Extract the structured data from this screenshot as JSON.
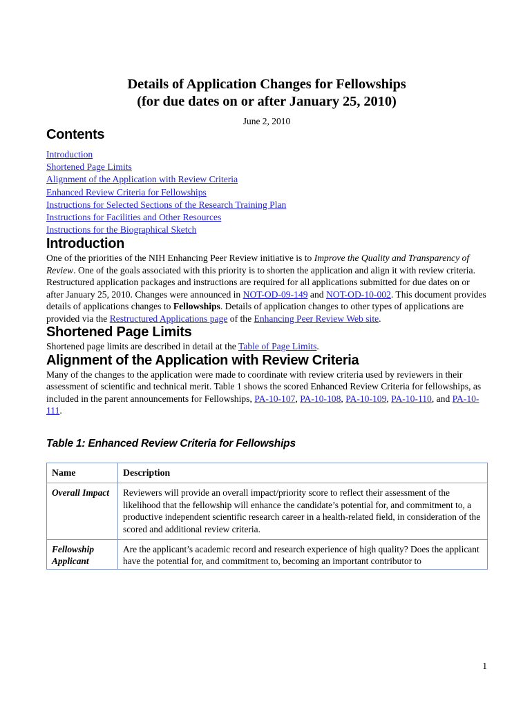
{
  "document": {
    "title_line1": "Details of Application Changes for Fellowships",
    "title_line2": "(for due dates on or after January 25, 2010)",
    "date": "June 2, 2010",
    "page_number": "1"
  },
  "contents": {
    "heading": "Contents",
    "items": [
      {
        "label": "Introduction"
      },
      {
        "label": "Shortened Page Limits"
      },
      {
        "label": "Alignment of the Application with Review Criteria"
      },
      {
        "label": "Enhanced Review Criteria for Fellowships"
      },
      {
        "label": "Instructions for Selected Sections of the Research Training Plan"
      },
      {
        "label": "Instructions for Facilities and Other Resources"
      },
      {
        "label": "Instructions for the Biographical Sketch"
      }
    ]
  },
  "introduction": {
    "heading": "Introduction",
    "para1_part1": "One of the priorities of the NIH Enhancing Peer Review initiative is to ",
    "para1_italic1": "Improve the Quality and Transparency of Review",
    "para1_part2": ".  One of the goals associated with this priority is to shorten the application and align it with review criteria.",
    "para2_part1": "Restructured application packages and instructions are required for all applications submitted for due dates on or after January 25, 2010. Changes were announced in ",
    "para2_link1": "NOT-OD-09-149",
    "para2_part2": " and ",
    "para2_link2": "NOT-OD-10-002",
    "para2_part3": ". This document provides details of applications changes to ",
    "para2_bold1": "Fellowships",
    "para2_part4": ".  Details of application changes to other types of applications are provided via the ",
    "para2_link3": "Restructured Applications page",
    "para2_part5": " of the ",
    "para2_link4": "Enhancing Peer Review Web site",
    "para2_part6": "."
  },
  "shortened_page_limits": {
    "heading": "Shortened Page Limits",
    "para_part1": "Shortened page limits are described in detail at the ",
    "para_link1": "Table of Page Limits",
    "para_part2": "."
  },
  "alignment": {
    "heading": "Alignment of the Application with Review Criteria",
    "para_part1": "Many of the changes to the application were made to coordinate with review criteria used by reviewers in their assessment of scientific and technical merit.   Table 1 shows the scored Enhanced Review Criteria for fellowships, as included in the parent announcements for Fellowships, ",
    "para_link1": "PA-10-107",
    "para_sep1": ", ",
    "para_link2": "PA-10-108",
    "para_sep2": ", ",
    "para_link3": "PA-10-109",
    "para_sep3": ", ",
    "para_link4": "PA-10-110",
    "para_sep4": ", and ",
    "para_link5": "PA-10-111",
    "para_part2": "."
  },
  "table1": {
    "heading": "Table 1: Enhanced Review Criteria for Fellowships",
    "columns": [
      "Name",
      "Description"
    ],
    "rows": [
      {
        "name": "Overall Impact",
        "description": "Reviewers will provide an overall impact/priority score to reflect their assessment of the likelihood that the fellowship will enhance the candidate’s potential for, and commitment to, a productive independent scientific research career in a health-related field, in consideration of the scored and additional review criteria."
      },
      {
        "name": "Fellowship Applicant",
        "description": "Are the applicant’s academic record and research experience of high quality? Does the applicant have the potential for, and commitment to, becoming an important contributor to"
      }
    ]
  },
  "colors": {
    "link": "#2222cc",
    "table_border": "#8196c8",
    "text": "#000000",
    "background": "#ffffff"
  }
}
